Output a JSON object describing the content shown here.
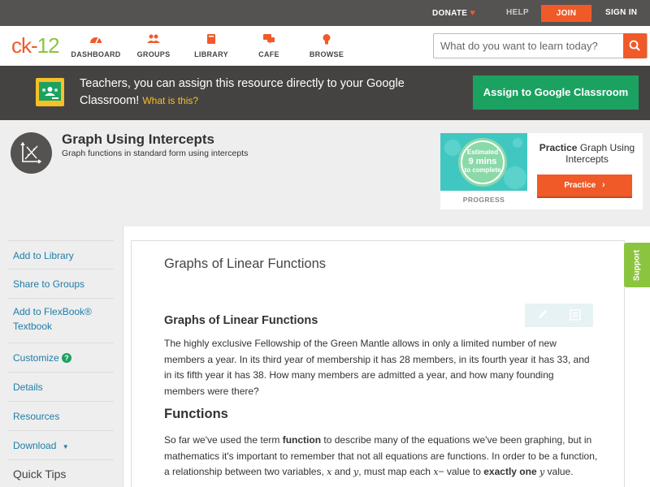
{
  "topbar": {
    "donate": "DONATE",
    "help": "HELP",
    "join": "JOIN",
    "signin": "SIGN IN"
  },
  "header": {
    "logo_ck": "ck",
    "logo_dash": "-",
    "logo_num": "12",
    "nav": [
      "DASHBOARD",
      "GROUPS",
      "LIBRARY",
      "CAFE",
      "BROWSE"
    ],
    "search_placeholder": "What do you want to learn today?"
  },
  "banner": {
    "message": "Teachers, you can assign this resource directly to your Google Classroom!",
    "what": "What is this?",
    "assign_button": "Assign to Google Classroom"
  },
  "concept": {
    "title": "Graph Using Intercepts",
    "subtitle": "Graph functions in standard form using intercepts"
  },
  "practice": {
    "estimated_line1": "Estimated",
    "estimated_line2": "9 mins",
    "estimated_line3": "to complete",
    "progress_label": "PROGRESS",
    "title_bold": "Practice",
    "title_rest": "Graph Using Intercepts",
    "button": "Practice"
  },
  "sidebar": {
    "items": [
      "Add to Library",
      "Share to Groups",
      "Add to FlexBook® Textbook",
      "Customize",
      "Details",
      "Resources",
      "Download"
    ],
    "quick_tips": "Quick Tips"
  },
  "article": {
    "title": "Graphs of Linear Functions",
    "heading1": "Graphs of Linear Functions",
    "para1": "The highly exclusive Fellowship of the Green Mantle allows in only a limited number of new members a year. In its third year of membership it has 28 members, in its fourth year it has 33, and in its fifth year it has 38. How many members are admitted a year, and how many founding members were there?",
    "heading2": "Functions",
    "para2_a": "So far we've used the term ",
    "para2_b": "function",
    "para2_c": " to describe many of the equations we've been graphing, but in mathematics it's important to remember that not all equations are functions. In order to be a function, a relationship between two variables, ",
    "var_x": "x",
    "para2_d": " and ",
    "var_y": "y",
    "para2_e": ", must map each ",
    "para2_f": "− value to ",
    "para2_g": "exactly",
    "para2_h": "one",
    "para2_i": " value."
  },
  "support": "Support",
  "colors": {
    "brand_orange": "#f05a28",
    "brand_green": "#8bc53f",
    "classroom_green": "#1ba261",
    "link_blue": "#1e7da8"
  }
}
